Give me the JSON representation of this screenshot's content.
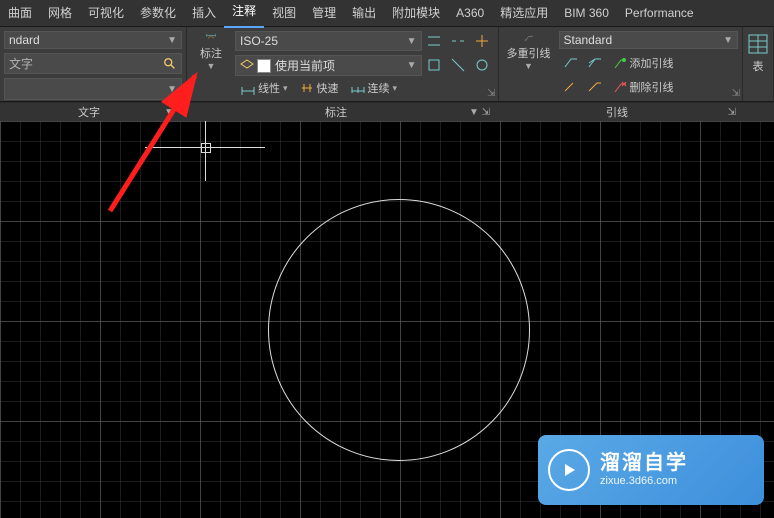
{
  "menu": {
    "items": [
      "曲面",
      "网格",
      "可视化",
      "参数化",
      "插入",
      "注释",
      "视图",
      "管理",
      "输出",
      "附加模块",
      "A360",
      "精选应用",
      "BIM 360",
      "Performance"
    ],
    "active_index": 5
  },
  "textPanel": {
    "style": "ndard",
    "field": "文字",
    "title": "文字"
  },
  "dimPanel": {
    "bigIcon": "标注",
    "style": "ISO-25",
    "layer": "使用当前项",
    "linear": "线性",
    "quick": "快速",
    "continue": "连续",
    "title": "标注"
  },
  "leaderPanel": {
    "bigIcon": "多重引线",
    "style": "Standard",
    "add": "添加引线",
    "remove": "删除引线",
    "title": "引线"
  },
  "tablePanel": {
    "label": "表"
  },
  "watermark": {
    "title": "溜溜自学",
    "url": "zixue.3d66.com"
  }
}
